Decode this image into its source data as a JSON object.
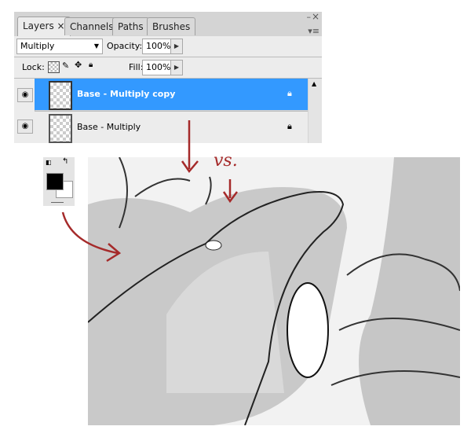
{
  "panel": {
    "tabs": [
      {
        "label": "Layers",
        "active": true
      },
      {
        "label": "Channels"
      },
      {
        "label": "Paths"
      },
      {
        "label": "Brushes"
      }
    ],
    "close_glyph": "×",
    "blend_mode": "Multiply",
    "opacity_label": "Opacity:",
    "opacity_value": "100%",
    "lock_label": "Lock:",
    "fill_label": "Fill:",
    "fill_value": "100%",
    "layers": [
      {
        "name": "Base - Multiply copy",
        "selected": true,
        "visible": true,
        "locked": true
      },
      {
        "name": "Base - Multiply",
        "selected": false,
        "visible": true,
        "locked": true
      }
    ]
  },
  "annotation": {
    "text": "vs.",
    "color": "#a52a2a"
  },
  "colors": {
    "selection": "#3399ff",
    "foreground": "#000000",
    "background": "#ffffff"
  }
}
